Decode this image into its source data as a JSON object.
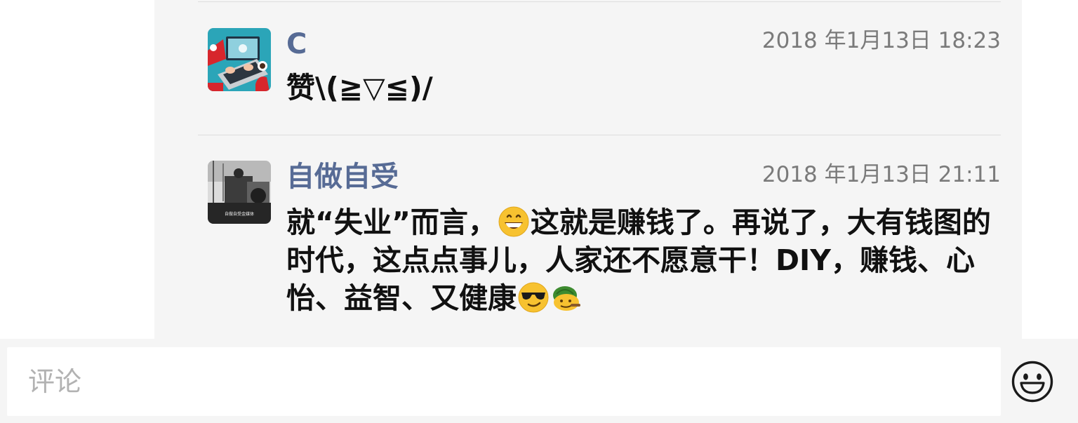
{
  "comments": [
    {
      "author": "C",
      "time": "2018 年1月13日 18:23",
      "text": "赞\\(≧▽≦)/"
    },
    {
      "author": "自做自受",
      "time": "2018 年1月13日 21:11",
      "text_part1": "就“失业”而言，",
      "text_part2": "这就是赚钱了。再说了，大有钱图的时代，这点点事儿，人家还不愿意干！DIY，赚钱、心怡、益智、又健康",
      "emojis": [
        "grinning-face-emoji",
        "smiling-face-with-sunglasses-emoji",
        "turtle-emoji"
      ],
      "avatar_caption": "自做自受金媒体"
    }
  ],
  "comment_box": {
    "placeholder": "评论"
  },
  "icons": {
    "emoji_button": "smiley-icon"
  },
  "colors": {
    "author_link": "#576b95",
    "panel_background": "#f5f5f5",
    "timestamp": "#7a7a7a"
  }
}
